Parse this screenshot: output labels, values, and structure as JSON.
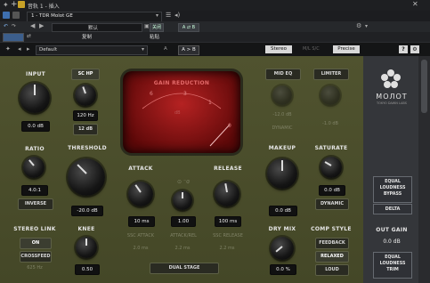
{
  "host": {
    "window_title": "音轨 1 - 插入",
    "track_selector": "1 - TDR Molot GE",
    "preset_default": "默认",
    "btn_bypass": "关闭",
    "btn_ab": "A ⇄ B",
    "btn_copy": "复制",
    "btn_paste": "粘贴"
  },
  "pluginbar": {
    "preset_name": "Default",
    "a_label": "A",
    "ab_label": "A > B",
    "stereo": "Stereo",
    "ms": "M/L S/C",
    "precise": "Precise",
    "help": "?",
    "settings": "⚙"
  },
  "input": {
    "label": "INPUT",
    "value": "0.0 dB"
  },
  "sc_hp": {
    "label": "SC HP",
    "value": "120 Hz",
    "slope": "12 dB"
  },
  "ratio": {
    "label": "RATIO",
    "value": "4.0:1",
    "inverse": "INVERSE"
  },
  "threshold": {
    "label": "THRESHOLD",
    "value": "-20.0 dB"
  },
  "stereo_link": {
    "label": "STEREO LINK",
    "on": "ON",
    "crossfeed": "CROSSFEED",
    "crossfeed_val": "625 Hz"
  },
  "knee": {
    "label": "KNEE",
    "value": "0.50"
  },
  "meter": {
    "title": "GAIN REDUCTION",
    "ticks": [
      "6",
      "3",
      "1",
      "0"
    ],
    "unit": "dB"
  },
  "attack": {
    "label": "ATTACK",
    "value": "10 ms",
    "sc_label": "SSC ATTACK",
    "sc_value": "2.0 ms"
  },
  "attack_rel": {
    "label": "ATTACK/REL",
    "value": "1.00",
    "sc_value": "2.2 ms"
  },
  "release": {
    "label": "RELEASE",
    "value": "100 ms",
    "sc_label": "SSC RELEASE",
    "sc_value": "2.2 ms"
  },
  "dual_stage": "DUAL STAGE",
  "mid_eq": {
    "label": "MID EQ",
    "value": "-12.0 dB",
    "dynamic": "DYNAMIC"
  },
  "limiter": {
    "label": "LIMITER",
    "value": "-1.0 dB"
  },
  "makeup": {
    "label": "MAKEUP",
    "value": "0.0 dB"
  },
  "saturate": {
    "label": "SATURATE",
    "value": "0.0 dB",
    "dynamic": "DYNAMIC"
  },
  "dry_mix": {
    "label": "DRY MIX",
    "value": "0.0 %"
  },
  "comp_style": {
    "label": "COMP STYLE",
    "feedback": "FEEDBACK",
    "relaxed": "RELAXED",
    "loud": "LOUD"
  },
  "logo": {
    "brand": "MOЛOT",
    "sub": "TOKYO DAWN LABS"
  },
  "side": {
    "eq_bypass": "EQUAL LOUDNESS BYPASS",
    "delta": "DELTA",
    "out_gain_label": "OUT GAIN",
    "out_gain_value": "0.0 dB",
    "eq_trim": "EQUAL LOUDNESS TRIM"
  }
}
